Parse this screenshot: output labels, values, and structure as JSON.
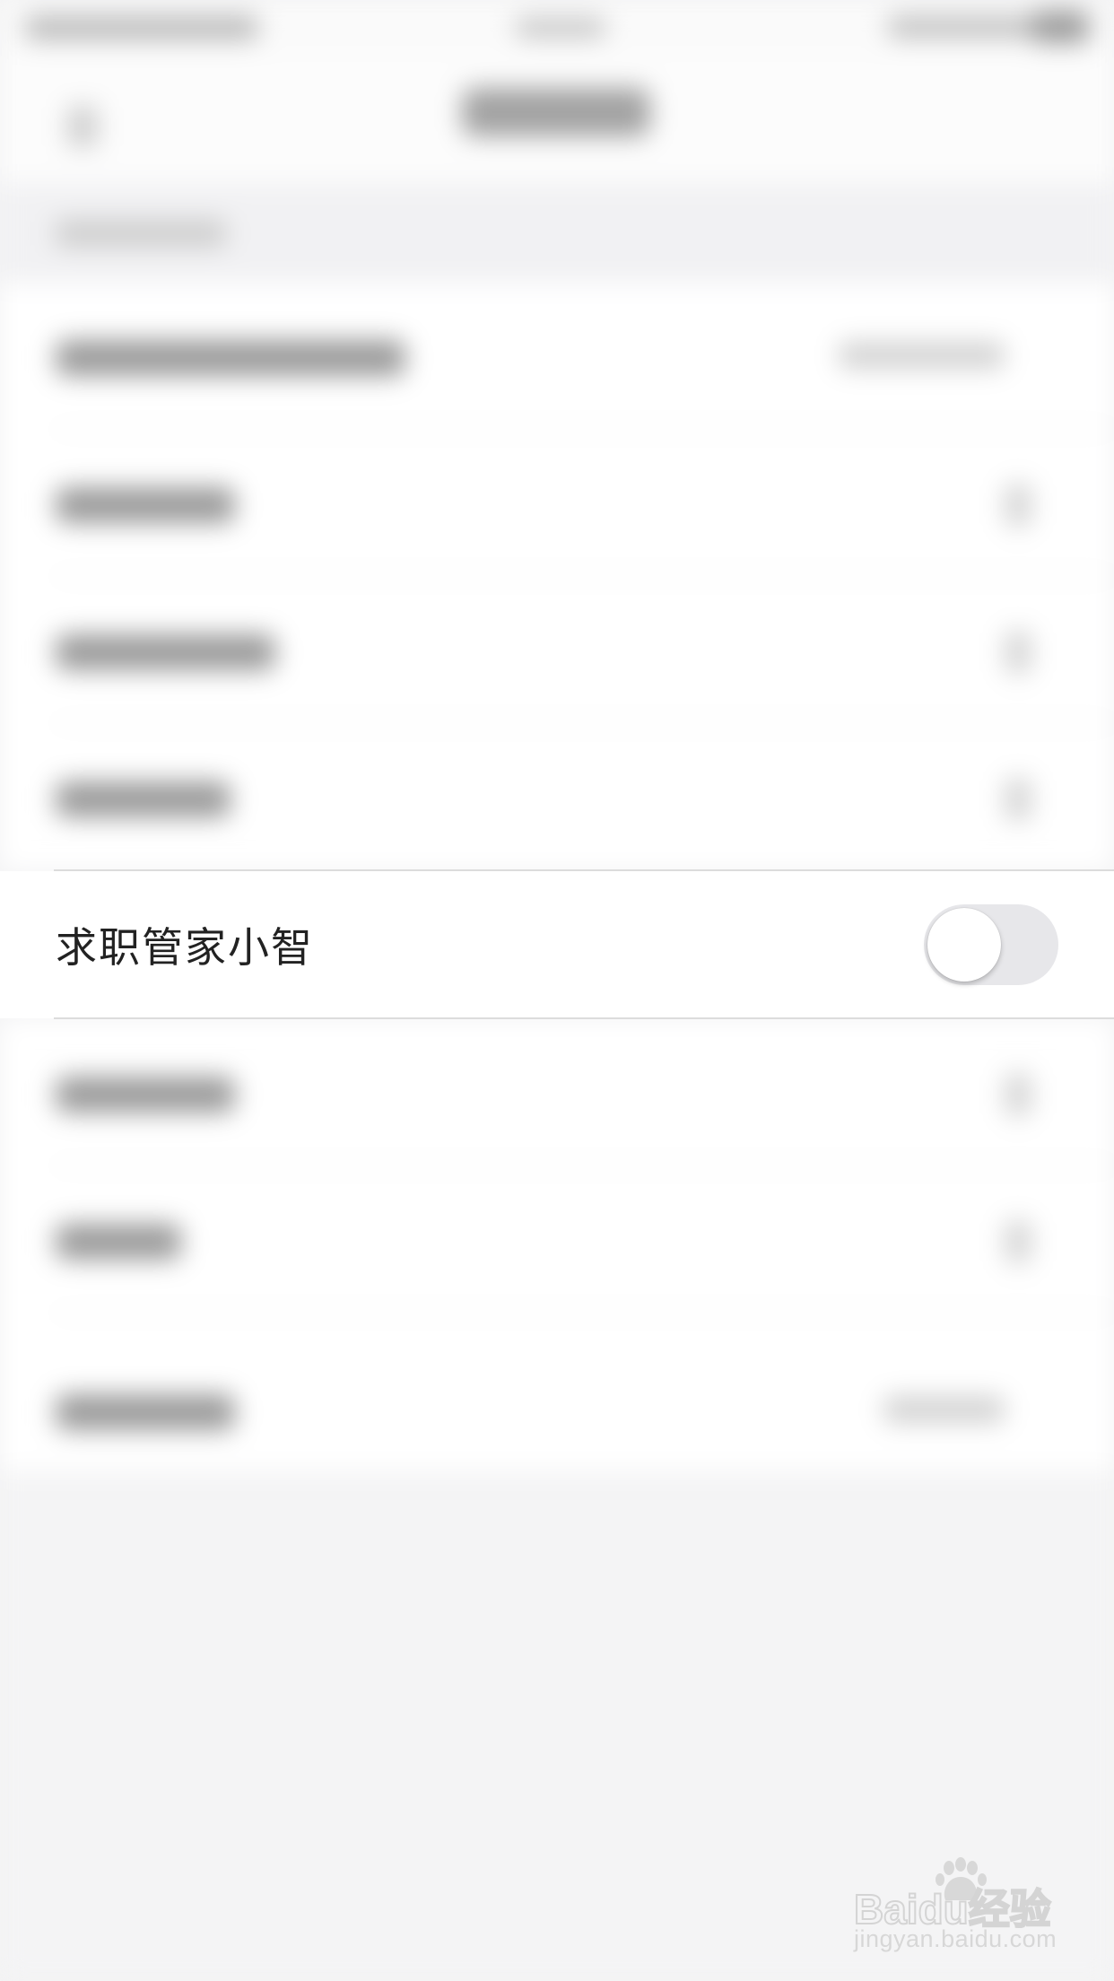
{
  "focused_setting": {
    "label": "求职管家小智",
    "toggle_on": false
  },
  "watermark": {
    "brand": "Baidu经验",
    "url": "jingyan.baidu.com"
  },
  "colors": {
    "toggle_off_track": "#e7e7ea",
    "toggle_knob": "#ffffff",
    "separator": "#dcdcdc",
    "page_background": "#f3f3f4"
  },
  "icons": [
    "back-arrow-icon",
    "chevron-right-icon",
    "baidu-paw-icon"
  ]
}
